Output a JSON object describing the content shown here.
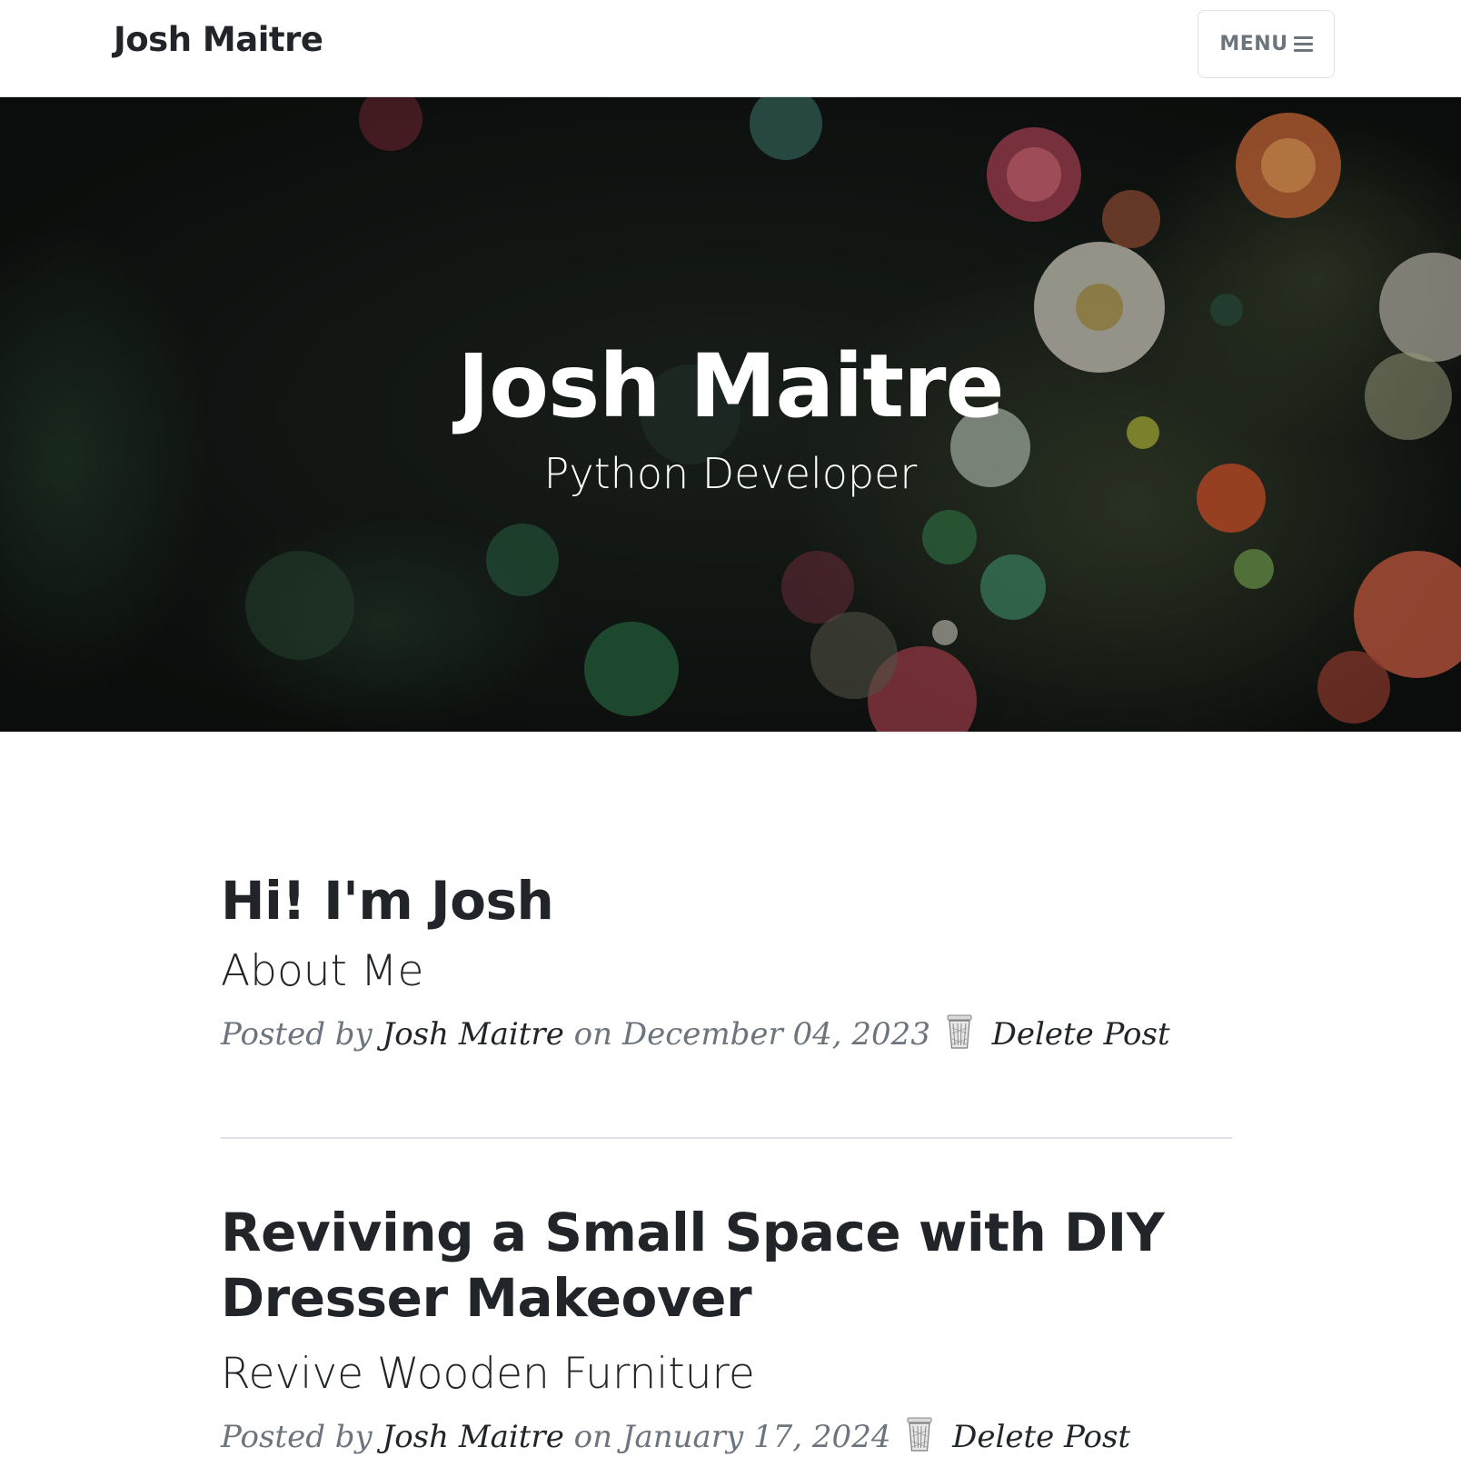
{
  "navbar": {
    "brand": "Josh Maitre",
    "menu_label": "MENU",
    "menu_icon": "hamburger-icon"
  },
  "hero": {
    "title": "Josh Maitre",
    "subtitle": "Python Developer"
  },
  "posts": [
    {
      "title": "Hi! I'm Josh",
      "subtitle": "About Me",
      "posted_by": "Posted by",
      "author": "Josh Maitre",
      "on": "on",
      "date": "December 04, 2023",
      "delete_icon": "trash-icon",
      "delete_label": "Delete Post"
    },
    {
      "title": "Reviving a Small Space with DIY Dresser Makeover",
      "subtitle": "Revive Wooden Furniture",
      "posted_by": "Posted by",
      "author": "Josh Maitre",
      "on": "on",
      "date": "January 17, 2024",
      "delete_icon": "trash-icon",
      "delete_label": "Delete Post"
    }
  ],
  "colors": {
    "text": "#212529",
    "muted": "#6c757d",
    "border": "#dee2e6",
    "hero_bg": "#141816"
  }
}
